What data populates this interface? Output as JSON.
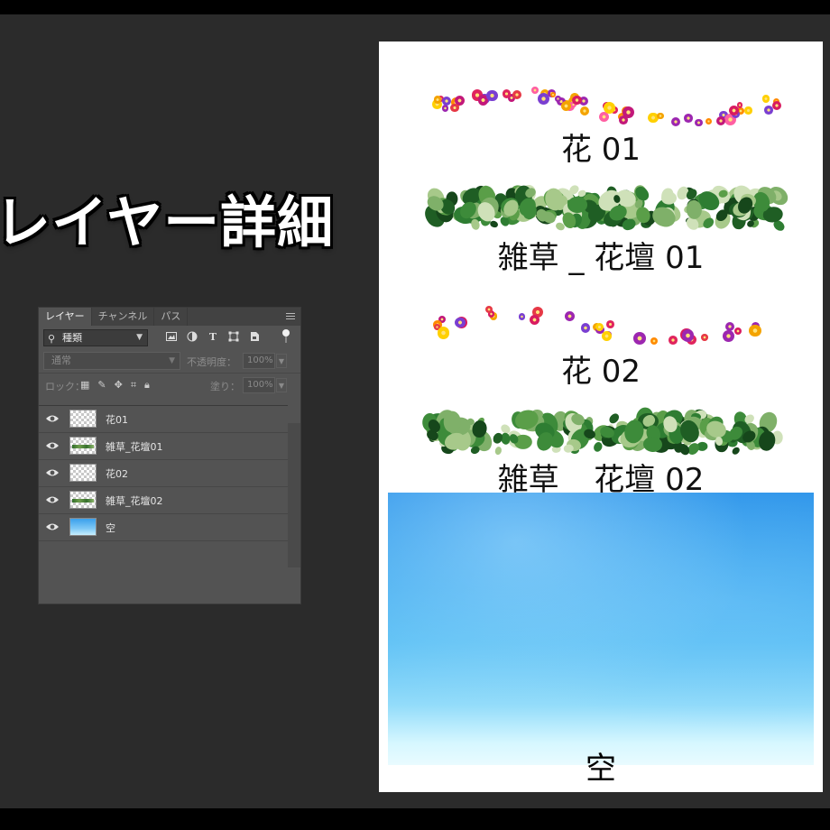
{
  "title": "レイヤー詳細",
  "panel": {
    "tabs": [
      "レイヤー",
      "チャンネル",
      "パス"
    ],
    "filter_label": "種類",
    "blend_mode": "通常",
    "opacity_label": "不透明度：",
    "opacity_value": "100%",
    "lock_label": "ロック：",
    "fill_label": "塗り：",
    "fill_value": "100%",
    "layers": [
      {
        "name": "花01",
        "thumb": "transparent"
      },
      {
        "name": "雑草_花壇01",
        "thumb": "grass"
      },
      {
        "name": "花02",
        "thumb": "transparent"
      },
      {
        "name": "雑草_花壇02",
        "thumb": "grass"
      },
      {
        "name": "空",
        "thumb": "sky"
      }
    ]
  },
  "canvas": {
    "labels": {
      "flower1": "花 01",
      "grass1": "雑草 _ 花壇 01",
      "flower2": "花 02",
      "grass2": "雑草 _ 花壇 02",
      "sky": "空"
    }
  },
  "colors": {
    "background": "#2b2b2b",
    "panel": "#535353",
    "canvas": "#ffffff",
    "sky_top": "#2f95ea",
    "sky_bottom": "#e9fbff"
  }
}
